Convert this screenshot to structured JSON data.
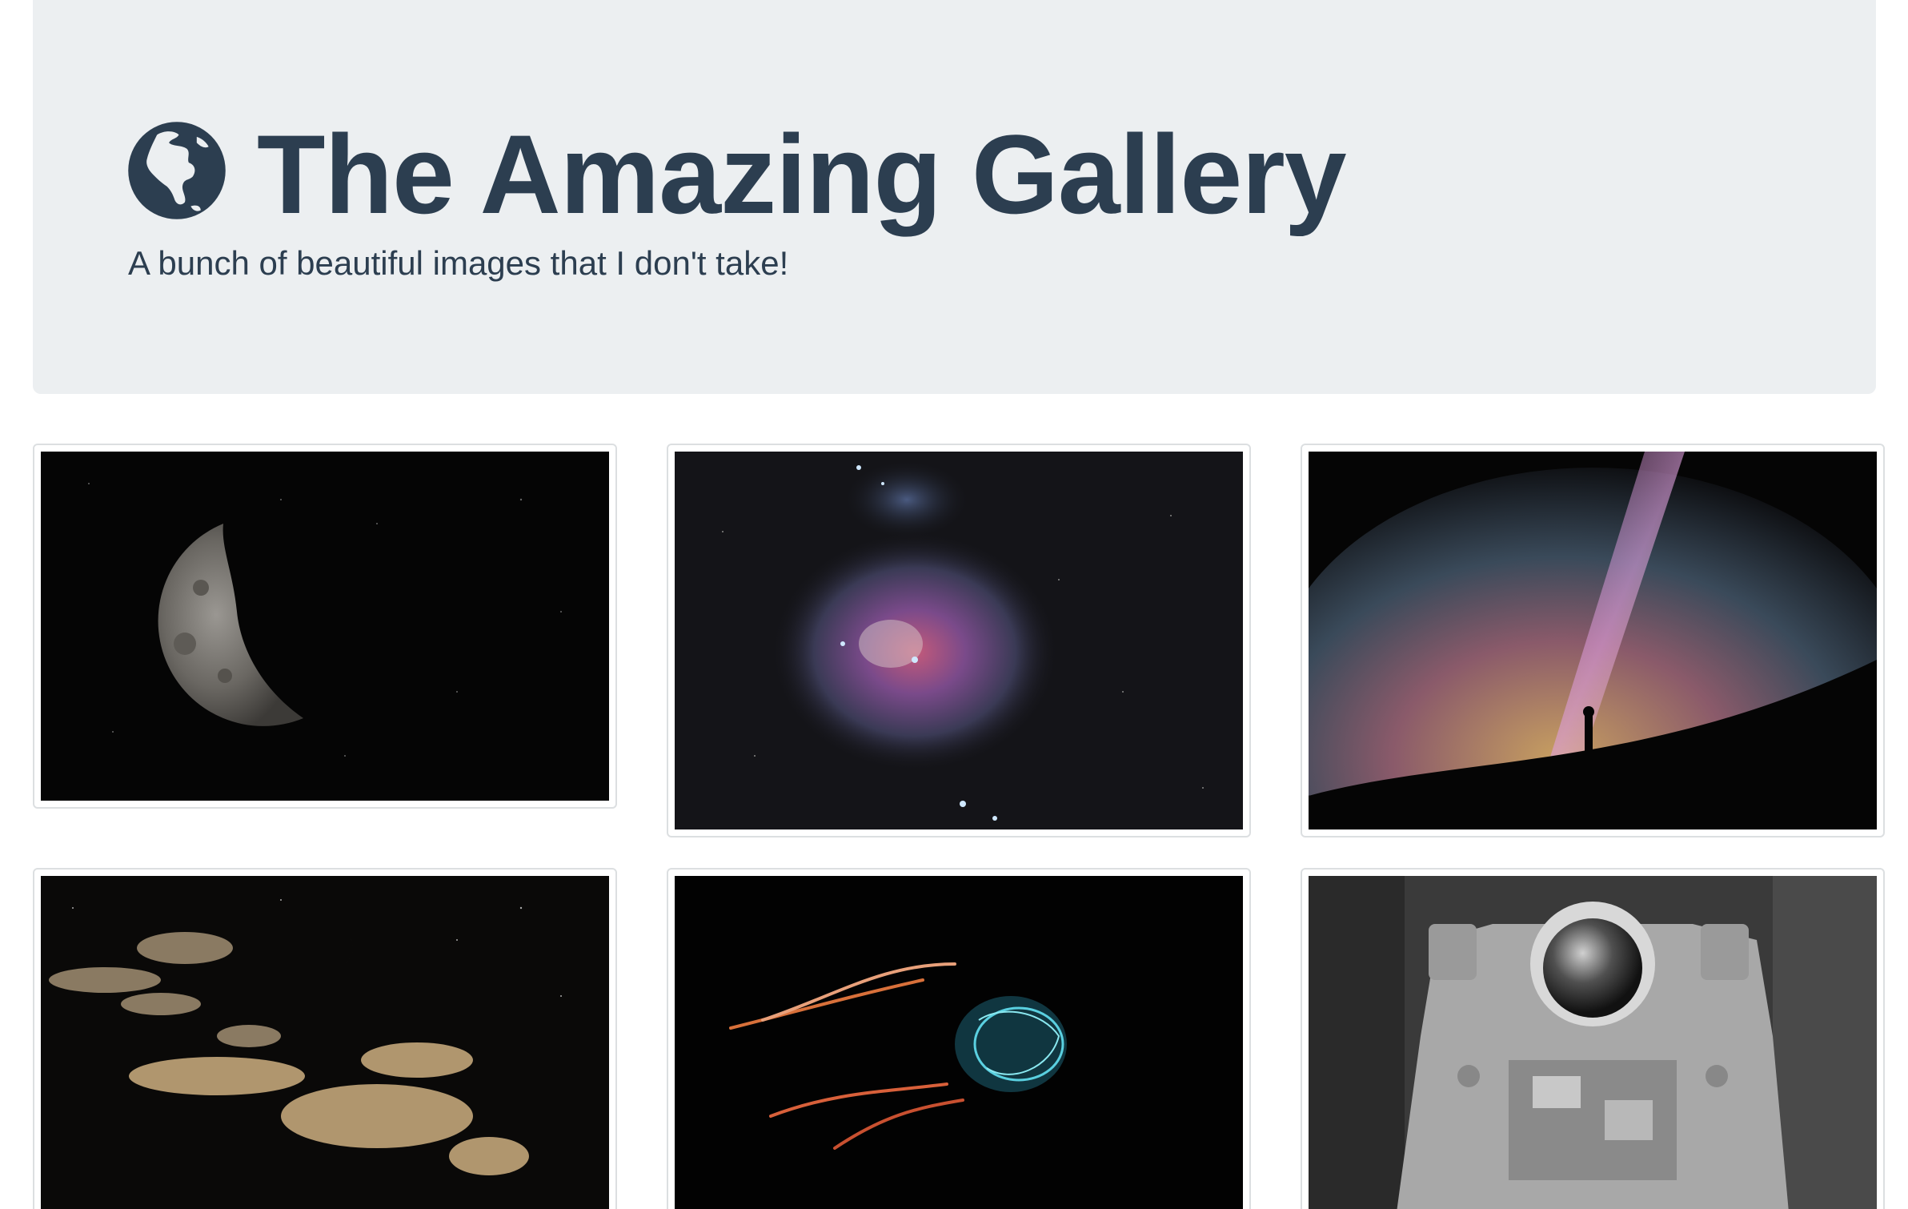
{
  "header": {
    "title": "The Amazing Gallery",
    "subtitle": "A bunch of beautiful images that I don't take!",
    "icon": "globe-americas-icon",
    "text_color": "#2c3e50",
    "background": "#eceff1"
  },
  "gallery": {
    "images": [
      {
        "subject": "half-moon-icon"
      },
      {
        "subject": "nebula-icon"
      },
      {
        "subject": "milky-way-silhouette-icon"
      },
      {
        "subject": "night-clouds-crescent-icon"
      },
      {
        "subject": "jellyfish-icon"
      },
      {
        "subject": "astronaut-suit-icon"
      }
    ]
  }
}
